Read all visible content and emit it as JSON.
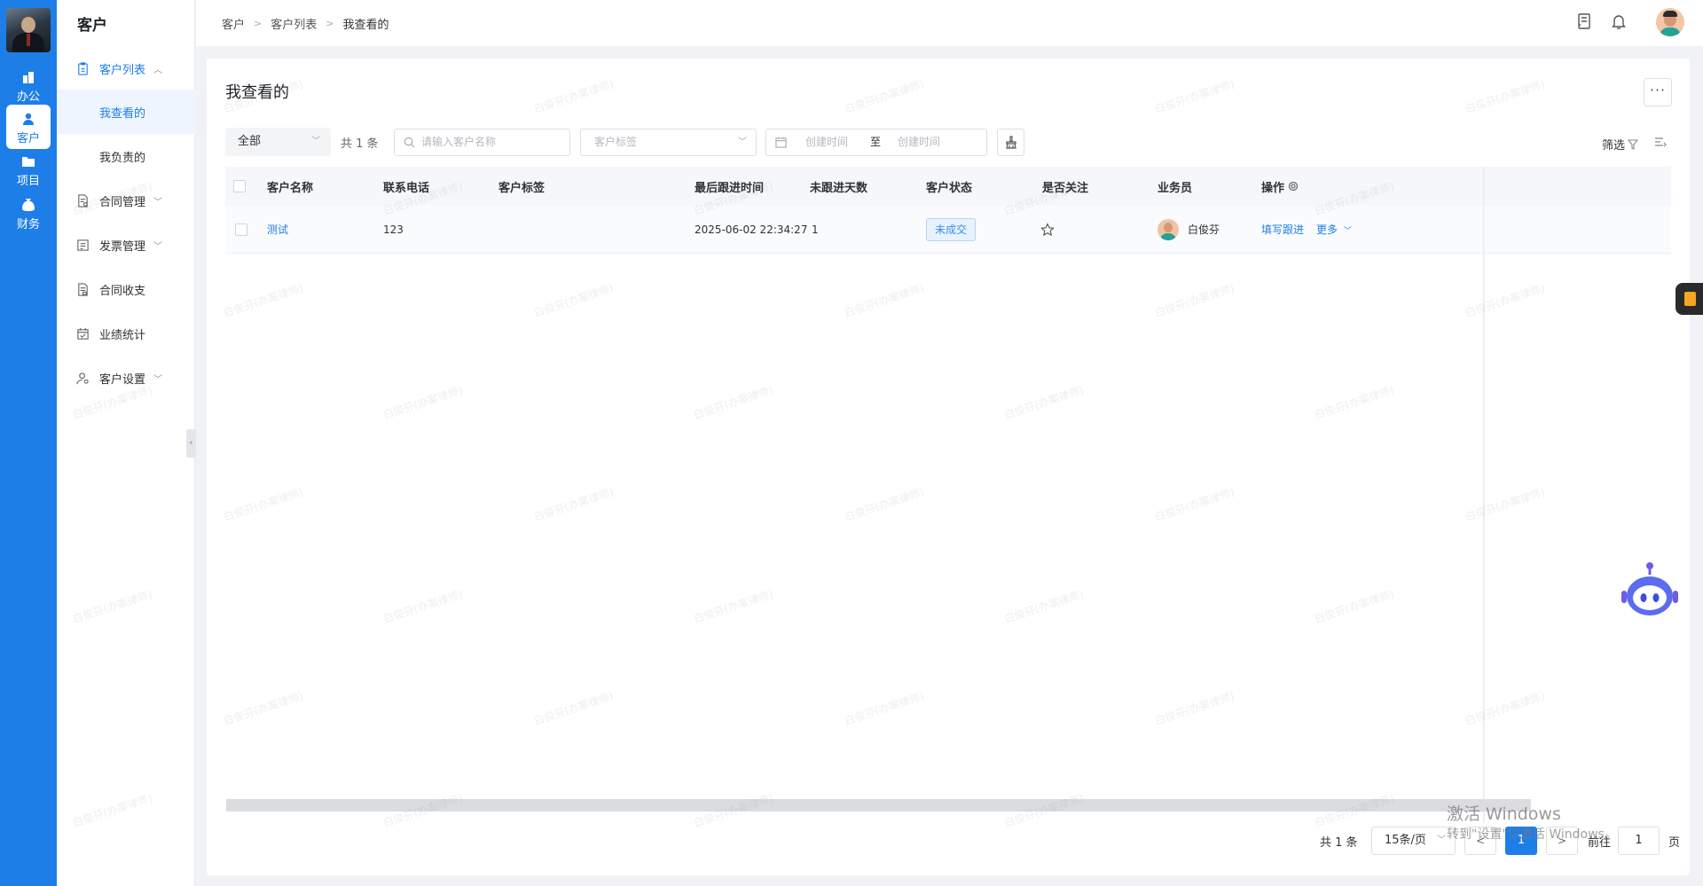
{
  "rail": {
    "items": [
      {
        "label": "办公",
        "icon": "office-icon"
      },
      {
        "label": "客户",
        "icon": "customer-icon",
        "active": true
      },
      {
        "label": "项目",
        "icon": "project-icon"
      },
      {
        "label": "财务",
        "icon": "finance-icon"
      }
    ]
  },
  "sidebar": {
    "title": "客户",
    "items": [
      {
        "label": "客户列表",
        "icon": "clipboard-icon",
        "expanded": true
      },
      {
        "label": "我查看的",
        "selected": true
      },
      {
        "label": "我负责的"
      },
      {
        "label": "合同管理",
        "icon": "contract-icon"
      },
      {
        "label": "发票管理",
        "icon": "invoice-icon"
      },
      {
        "label": "合同收支",
        "icon": "contract-finance-icon"
      },
      {
        "label": "业绩统计",
        "icon": "calendar-icon"
      },
      {
        "label": "客户设置",
        "icon": "user-settings-icon"
      }
    ]
  },
  "breadcrumb": [
    "客户",
    "客户列表",
    "我查看的"
  ],
  "page": {
    "title": "我查看的",
    "more": "···"
  },
  "filters": {
    "scope": "全部",
    "count": "共 1 条",
    "search_placeholder": "请输入客户名称",
    "tag_placeholder": "客户标签",
    "date_start": "创建时间",
    "date_to": "至",
    "date_end": "创建时间",
    "filter_label": "筛选"
  },
  "table": {
    "columns": [
      "客户名称",
      "联系电话",
      "客户标签",
      "最后跟进时间",
      "未跟进天数",
      "客户状态",
      "是否关注",
      "业务员",
      "操作"
    ],
    "rows": [
      {
        "name": "测试",
        "phone": "123",
        "tags": "",
        "last_follow": "2025-06-02 22:34:27",
        "days": "1",
        "status": "未成交",
        "salesperson": "白俊芬",
        "action_follow": "填写跟进",
        "action_more": "更多"
      }
    ]
  },
  "pagination": {
    "total": "共 1 条",
    "page_size": "15条/页",
    "prev": "<",
    "current": "1",
    "next": ">",
    "goto_label": "前往",
    "goto_value": "1",
    "page_unit": "页"
  },
  "os_watermark": {
    "line1": "激活 Windows",
    "line2": "转到\"设置\"以激活 Windows。"
  },
  "watermark_text": "白俊芬(办案律师)",
  "colors": {
    "primary": "#1e7ee8",
    "badge_bg": "#e8f2fe"
  }
}
